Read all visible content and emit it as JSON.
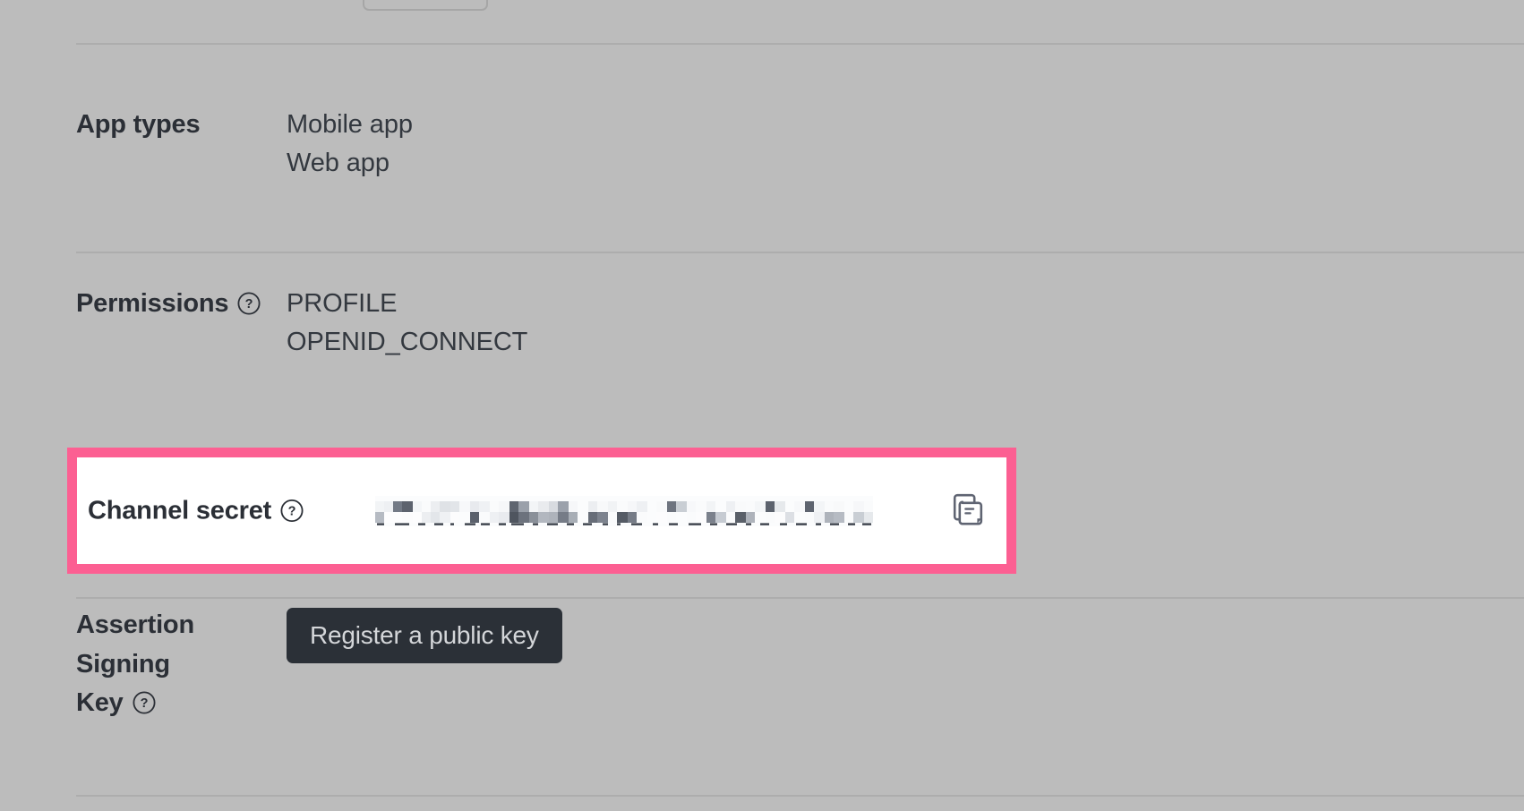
{
  "theme": {
    "page_background": "#bcbcbc",
    "divider_color": "#adadad",
    "label_color": "#2b2f36",
    "value_color": "#33383f",
    "highlight_border_color": "#fc5f92",
    "highlight_fill_color": "#ffffff",
    "button_background": "#2b3037",
    "button_text_color": "#d4d6d9",
    "icon_color": "#5f6472"
  },
  "rows": {
    "app_types": {
      "label": "App types",
      "values": [
        "Mobile app",
        "Web app"
      ],
      "has_help_icon": false
    },
    "permissions": {
      "label": "Permissions",
      "values": [
        "PROFILE",
        "OPENID_CONNECT"
      ],
      "has_help_icon": true,
      "help_icon_name": "help-icon"
    },
    "channel_secret": {
      "label": "Channel secret",
      "has_help_icon": true,
      "help_icon_name": "help-icon",
      "value_state": "redacted",
      "value_text": "",
      "copy_icon_name": "copy-icon",
      "highlighted": true
    },
    "assertion_signing_key": {
      "label": "Assertion Signing Key",
      "label_line_1": "Assertion Signing",
      "label_line_2": "Key",
      "has_help_icon": true,
      "help_icon_name": "help-icon",
      "button_label": "Register a public key"
    }
  },
  "icons": {
    "help": "?",
    "copy": "copy-documents"
  }
}
